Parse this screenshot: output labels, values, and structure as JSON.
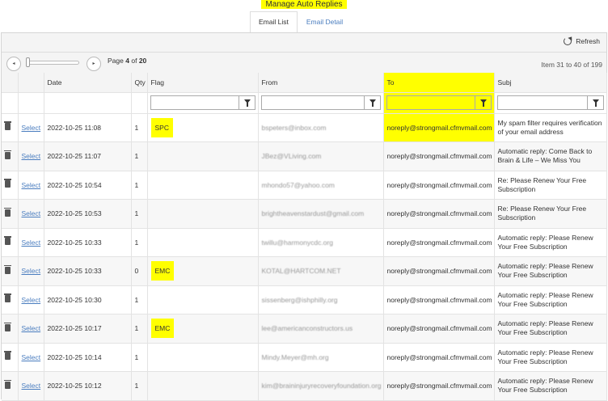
{
  "page_title": "Manage Auto Replies",
  "tabs": [
    {
      "label": "Email List"
    },
    {
      "label": "Email Detail"
    }
  ],
  "toolbar": {
    "refresh_label": "Refresh"
  },
  "pager": {
    "page_prefix": "Page",
    "current_page": "4",
    "page_of": "of",
    "total_pages": "20",
    "item_info": "Item 31 to 40 of 199",
    "prev_icon": "◂",
    "next_icon": "▸"
  },
  "columns": [
    "Date",
    "Qty",
    "Flag",
    "From",
    "To",
    "Subj"
  ],
  "select_label": "Select",
  "rows": [
    {
      "date": "2022-10-25 11:08",
      "qty": "1",
      "flag": "SPC",
      "from": "bspeters@inbox.com",
      "to": "noreply@strongmail.cfmvmail.com",
      "subj": "My spam filter requires verification of your email address"
    },
    {
      "date": "2022-10-25 11:07",
      "qty": "1",
      "flag": "",
      "from": "JBez@VLiving.com",
      "to": "noreply@strongmail.cfmvmail.com",
      "subj": "Automatic reply: Come Back to Brain & Life – We Miss You"
    },
    {
      "date": "2022-10-25 10:54",
      "qty": "1",
      "flag": "",
      "from": "mhondo57@yahoo.com",
      "to": "noreply@strongmail.cfmvmail.com",
      "subj": "Re: Please Renew Your Free Subscription"
    },
    {
      "date": "2022-10-25 10:53",
      "qty": "1",
      "flag": "",
      "from": "brightheavenstardust@gmail.com",
      "to": "noreply@strongmail.cfmvmail.com",
      "subj": "Re: Please Renew Your Free Subscription"
    },
    {
      "date": "2022-10-25 10:33",
      "qty": "1",
      "flag": "",
      "from": "twillu@harmonycdc.org",
      "to": "noreply@strongmail.cfmvmail.com",
      "subj": "Automatic reply: Please Renew Your Free Subscription"
    },
    {
      "date": "2022-10-25 10:33",
      "qty": "0",
      "flag": "EMC",
      "from": "KOTAL@HARTCOM.NET",
      "to": "noreply@strongmail.cfmvmail.com",
      "subj": "Automatic reply: Please Renew Your Free Subscription"
    },
    {
      "date": "2022-10-25 10:30",
      "qty": "1",
      "flag": "",
      "from": "sissenberg@ishphilly.org",
      "to": "noreply@strongmail.cfmvmail.com",
      "subj": "Automatic reply: Please Renew Your Free Subscription"
    },
    {
      "date": "2022-10-25 10:17",
      "qty": "1",
      "flag": "EMC",
      "from": "lee@americanconstructors.us",
      "to": "noreply@strongmail.cfmvmail.com",
      "subj": "Automatic reply: Please Renew Your Free Subscription"
    },
    {
      "date": "2022-10-25 10:14",
      "qty": "1",
      "flag": "",
      "from": "Mindy.Meyer@mh.org",
      "to": "noreply@strongmail.cfmvmail.com",
      "subj": "Automatic reply: Please Renew Your Free Subscription"
    },
    {
      "date": "2022-10-25 10:12",
      "qty": "1",
      "flag": "",
      "from": "kim@braininjuryrecoveryfoundation.org",
      "to": "noreply@strongmail.cfmvmail.com",
      "subj": "Automatic reply: Please Renew Your Free Subscription"
    }
  ],
  "colors": {
    "highlight": "#ffff00",
    "link": "#4a7dbf"
  }
}
